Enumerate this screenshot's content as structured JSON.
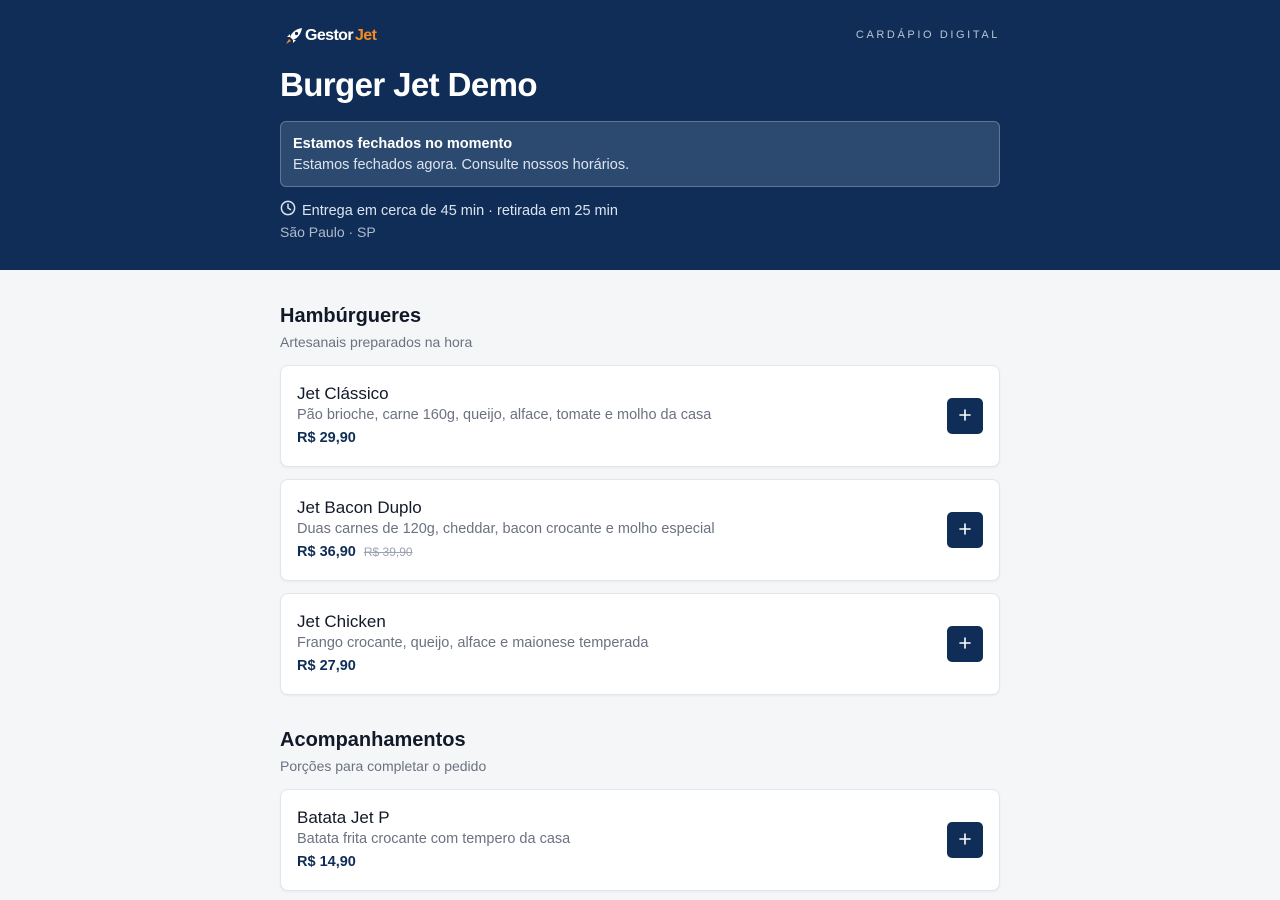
{
  "brand": {
    "logo_part1": "Gestor",
    "logo_part2": "Jet",
    "tagline": "CARDÁPIO DIGITAL"
  },
  "store": {
    "name": "Burger Jet Demo",
    "notice": {
      "title": "Estamos fechados no momento",
      "text": "Estamos fechados agora. Consulte nossos horários."
    },
    "delivery": "Entrega em cerca de 45 min · retirada em 25 min",
    "location": "São Paulo · SP"
  },
  "categories": [
    {
      "title": "Hambúrgueres",
      "subtitle": "Artesanais preparados na hora",
      "items": [
        {
          "name": "Jet Clássico",
          "description": "Pão brioche, carne 160g, queijo, alface, tomate e molho da casa",
          "price": "R$ 29,90",
          "old_price": ""
        },
        {
          "name": "Jet Bacon Duplo",
          "description": "Duas carnes de 120g, cheddar, bacon crocante e molho especial",
          "price": "R$ 36,90",
          "old_price": "R$ 39,90"
        },
        {
          "name": "Jet Chicken",
          "description": "Frango crocante, queijo, alface e maionese temperada",
          "price": "R$ 27,90",
          "old_price": ""
        }
      ]
    },
    {
      "title": "Acompanhamentos",
      "subtitle": "Porções para completar o pedido",
      "items": [
        {
          "name": "Batata Jet P",
          "description": "Batata frita crocante com tempero da casa",
          "price": "R$ 14,90",
          "old_price": ""
        }
      ]
    }
  ],
  "icons": {
    "logo": "rocket-icon",
    "delivery": "clock-icon",
    "add": "plus-icon"
  },
  "colors": {
    "header": "#0f2d56",
    "accent": "#f58a1f",
    "button": "#0f2d56",
    "background": "#f5f6f8"
  }
}
